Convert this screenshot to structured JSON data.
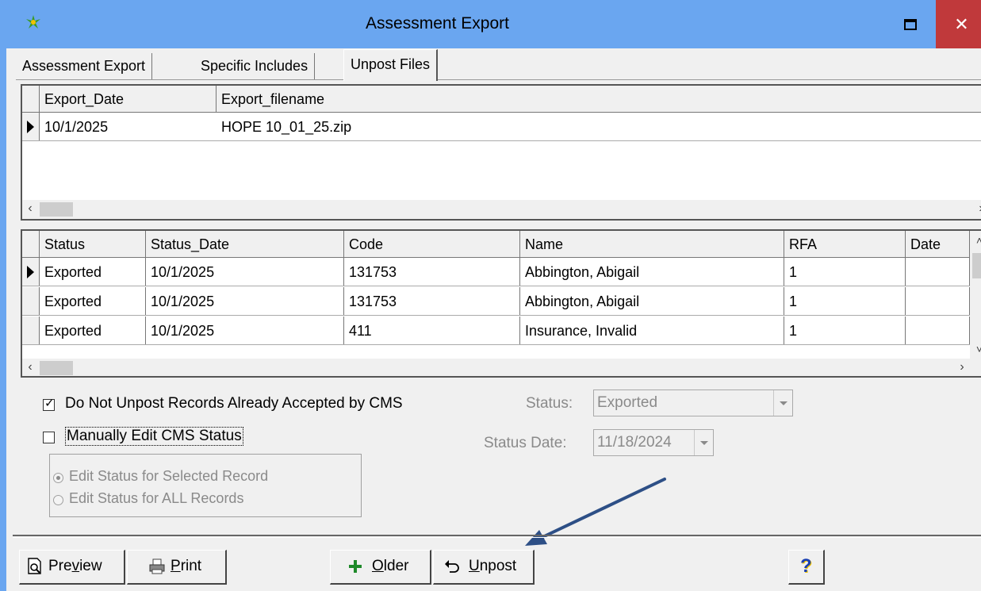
{
  "window": {
    "title": "Assessment Export",
    "maximize_icon": "maximize-icon",
    "close_glyph": "✕"
  },
  "tabs": [
    {
      "label": "Assessment Export"
    },
    {
      "label": "Specific Includes"
    },
    {
      "label": "Unpost Files"
    }
  ],
  "files_grid": {
    "columns": [
      "Export_Date",
      "Export_filename"
    ],
    "rows": [
      {
        "export_date": "10/1/2025",
        "export_filename": "HOPE 10_01_25.zip"
      }
    ]
  },
  "records_grid": {
    "columns": [
      "Status",
      "Status_Date",
      "Code",
      "Name",
      "RFA",
      "Date"
    ],
    "rows": [
      {
        "status": "Exported",
        "status_date": "10/1/2025",
        "code": "131753",
        "name": "Abbington, Abigail",
        "rfa": "1",
        "date": ""
      },
      {
        "status": "Exported",
        "status_date": "10/1/2025",
        "code": "131753",
        "name": "Abbington, Abigail",
        "rfa": "1",
        "date": ""
      },
      {
        "status": "Exported",
        "status_date": "10/1/2025",
        "code": "411",
        "name": "Insurance, Invalid",
        "rfa": "1",
        "date": ""
      }
    ]
  },
  "options": {
    "do_not_unpost_label": "Do Not Unpost Records Already Accepted by CMS",
    "do_not_unpost_checked": true,
    "manual_edit_label": "Manually Edit CMS Status",
    "manual_edit_checked": false,
    "radio_selected_label": "Edit Status for Selected Record",
    "radio_all_label": "Edit Status for ALL Records"
  },
  "status_fields": {
    "status_label": "Status:",
    "status_value": "Exported",
    "status_date_label": "Status Date:",
    "status_date_value": "11/18/2024"
  },
  "buttons": {
    "preview_pre": "Pre",
    "preview_ul": "v",
    "preview_post": "iew",
    "print_ul": "P",
    "print_post": "rint",
    "older_ul": "O",
    "older_post": "lder",
    "unpost_ul": "U",
    "unpost_post": "npost",
    "help_glyph": "?"
  },
  "colors": {
    "titlebar": "#6aa6f0",
    "close": "#c0393b",
    "arrow": "#2d4f86"
  }
}
